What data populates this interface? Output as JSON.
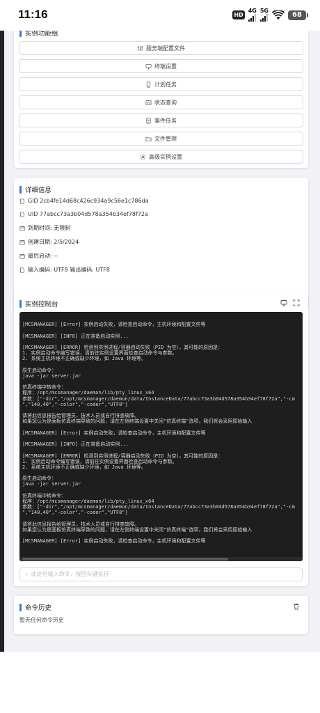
{
  "status_bar": {
    "time": "11:16",
    "hd_badge": "HD",
    "net1": "4G",
    "net2": "5G",
    "battery": "68"
  },
  "function_group": {
    "title": "实例功能组",
    "buttons": [
      {
        "label": "服务端配置文件",
        "icon": "sliders-icon"
      },
      {
        "label": "终端设置",
        "icon": "monitor-icon"
      },
      {
        "label": "计划任务",
        "icon": "phone-icon"
      },
      {
        "label": "状态查询",
        "icon": "dashboard-icon"
      },
      {
        "label": "事件任务",
        "icon": "document-icon"
      },
      {
        "label": "文件管理",
        "icon": "folder-icon"
      },
      {
        "label": "高级实例设置",
        "icon": "gear-icon"
      }
    ]
  },
  "details": {
    "title": "详细信息",
    "rows": [
      {
        "text": "GID 2cb4fe14d68c426c934a9c56e1c786da",
        "icon": "file-icon"
      },
      {
        "text": "UID 77abcc73a3b04d578a354b34ef78f72a",
        "icon": "file-icon"
      },
      {
        "text": "到期时间: 无限制",
        "icon": "calendar-icon"
      },
      {
        "text": "创建日期: 2/5/2024",
        "icon": "calendar-icon"
      },
      {
        "text": "最后启动: --",
        "icon": "calendar-icon"
      },
      {
        "text": "输入编码: UTF8 输出编码: UTF8",
        "icon": "file-icon"
      }
    ]
  },
  "console_card": {
    "title": "实例控制台",
    "lines": [
      "",
      "[MCSMANAGER] [Error] 实例启动失败，请检查启动命令，主机环境和配置文件等",
      "",
      "[MCSMANAGER] [INFO] 正在准备启动实例...",
      "",
      "[MCSMANAGER] [ERROR] 检测到实例进程/容器启动失败（PID 为空），其可能的原因是：",
      "1. 实例启动命令编写错误，请前往实例设置界面检查启动命令与参数。",
      "2. 系统主机环境不正确或缺少环境，如 Java 环境等。",
      "",
      "原生启动命令：",
      "java -jar server.jar",
      "",
      "仿真终端中转命令：",
      "程序：/opt/mcsmanager/daemon/lib/pty_linux_x64",
      "参数：[\"-dir\",\"/opt/mcsmanager/daemon/data/InstanceData/77abcc73a3b04d578a354b34ef78f72a\",\"-cm",
      "\",\"140,40\",\"-color\",\"-coder\",\"UTF8\"]",
      "",
      "请将此信息报告给管理员，技术人员或自行排查故障。",
      "如果您认为是面板仿真终端导致的问题，请在左侧终端设置中关闭\"仿真终端\"选项，我们将会采用原始输入",
      "",
      "[MCSMANAGER] [Error] 实例启动失败，请检查启动命令，主机环境和配置文件等",
      "",
      "[MCSMANAGER] [INFO] 正在准备启动实例...",
      "",
      "[MCSMANAGER] [ERROR] 检测到实例进程/容器启动失败（PID 为空），其可能的原因是：",
      "1. 实例启动命令编写错误，请前往实例设置界面检查启动命令与参数。",
      "2. 系统主机环境不正确或缺少环境，如 Java 环境等。",
      "",
      "原生启动命令：",
      "java -jar server.jar",
      "",
      "仿真终端中转命令：",
      "程序：/opt/mcsmanager/daemon/lib/pty_linux_x64",
      "参数：[\"-dir\",\"/opt/mcsmanager/daemon/data/InstanceData/77abcc73a3b04d578a354b34ef78f72a\",\"-cm",
      "\",\"140,40\",\"-color\",\"-coder\",\"UTF8\"]",
      "",
      "请将此信息报告给管理员，技术人员或自行排查故障。",
      "如果您认为是面板仿真终端导致的问题，请在左侧终端设置中关闭\"仿真终端\"选项，我们将会采用原始输入",
      "",
      "[MCSMANAGER] [Error] 实例启动失败，请检查启动命令，主机环境和配置文件等"
    ],
    "input_placeholder": "此处可输入命令，按回车键执行"
  },
  "history": {
    "title": "命令历史",
    "empty_text": "暂无任何命令历史"
  }
}
